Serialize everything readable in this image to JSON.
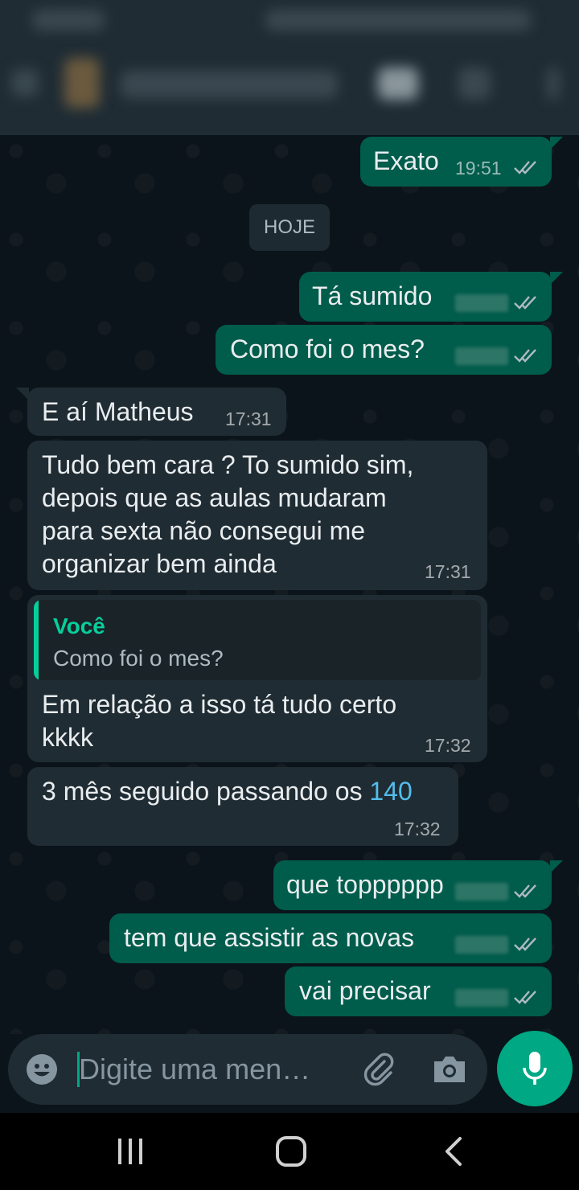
{
  "colors": {
    "outgoing_bubble": "#005c4b",
    "incoming_bubble": "#202c33",
    "accent": "#00a884",
    "link": "#53bdeb",
    "quote_author": "#06cf9c"
  },
  "date_chip": "HOJE",
  "messages": [
    {
      "text": "Exato",
      "time": "19:51"
    },
    {
      "text": "Tá sumido"
    },
    {
      "text": "Como foi o mes?"
    },
    {
      "text": "E aí Matheus",
      "time": "17:31"
    },
    {
      "lines": [
        "Tudo bem cara ? To sumido sim,",
        "depois que as aulas mudaram",
        "para sexta não consegui me",
        "organizar bem ainda"
      ],
      "time": "17:31"
    },
    {
      "quote_author": "Você",
      "quote_text": "Como foi o mes?",
      "lines": [
        "Em relação a isso tá tudo certo",
        "kkkk"
      ],
      "time": "17:32"
    },
    {
      "text_prefix": "3 mês seguido passando os ",
      "link": "140",
      "time": "17:32"
    },
    {
      "text": "que topppppp"
    },
    {
      "text": "tem que assistir as novas"
    },
    {
      "text": "vai precisar"
    }
  ],
  "input": {
    "placeholder": "Digite uma men…",
    "icons": [
      "emoji-icon",
      "attach-icon",
      "camera-icon",
      "mic-icon"
    ]
  },
  "navbar": {
    "icons": [
      "recents-icon",
      "home-icon",
      "back-icon"
    ]
  }
}
